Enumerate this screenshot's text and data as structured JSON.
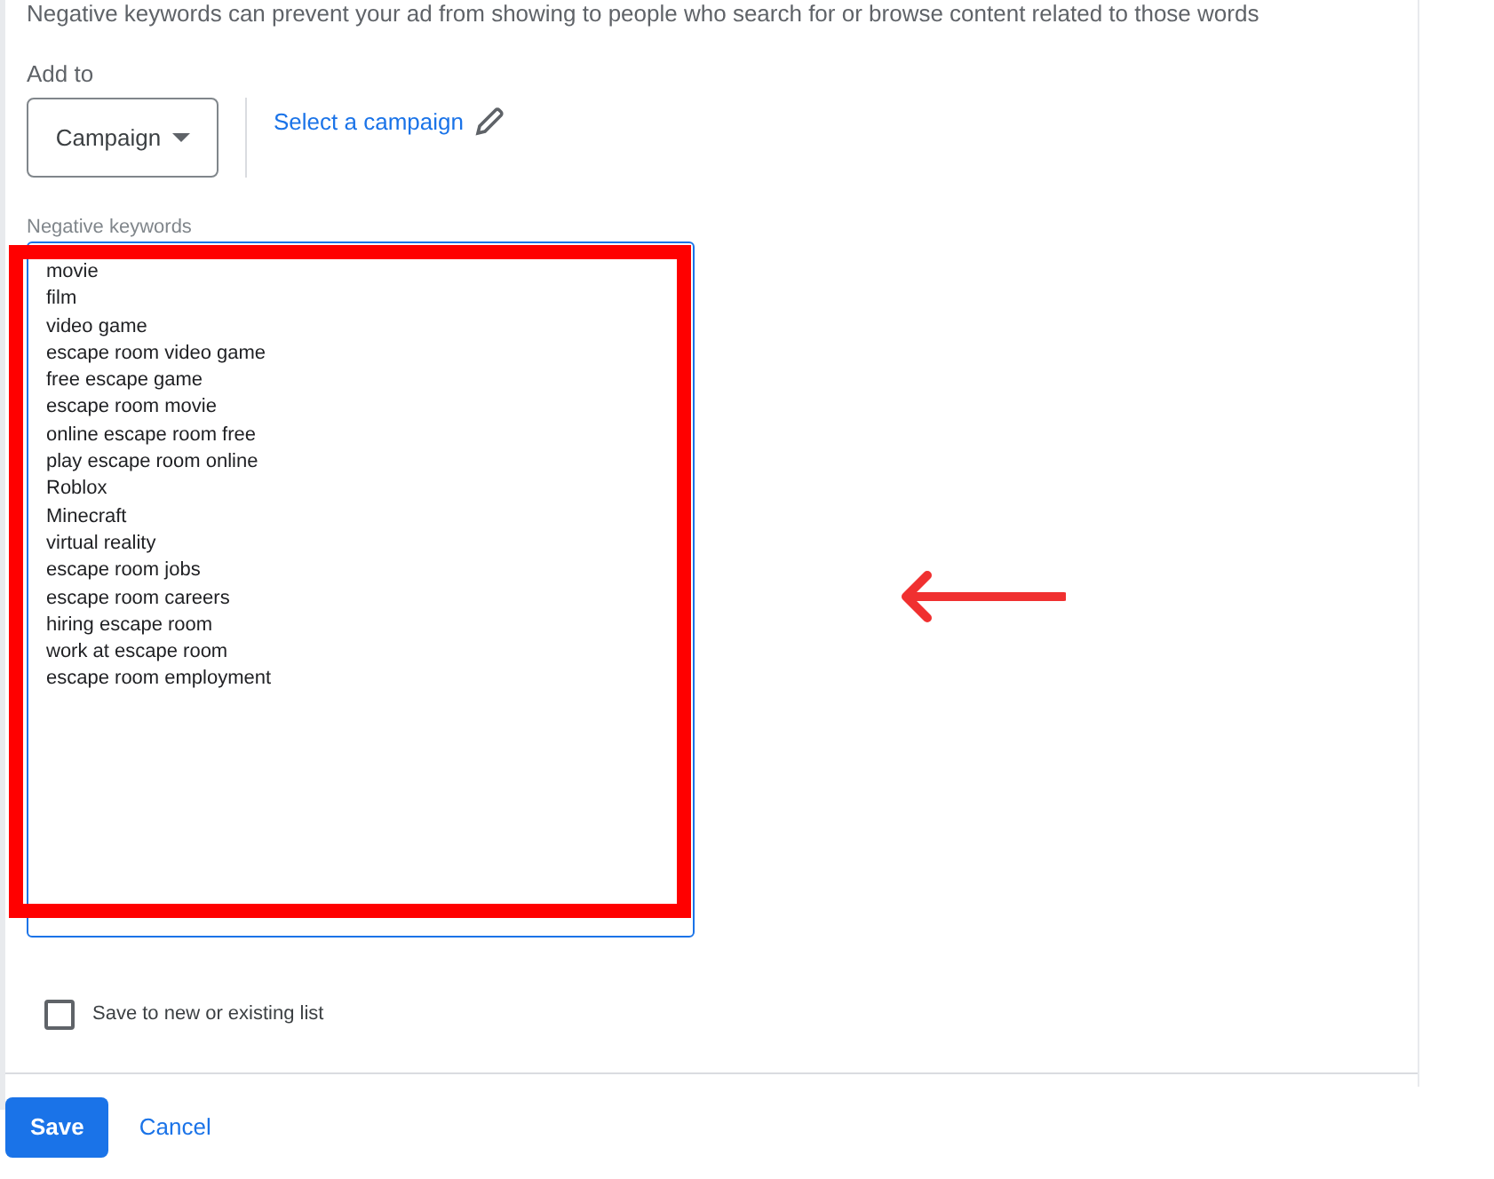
{
  "description": "Negative keywords can prevent your ad from showing to people who search for or browse content related to those words",
  "add_to": {
    "label": "Add to",
    "dropdown": "Campaign",
    "link": "Select a campaign"
  },
  "keywords_field": {
    "label": "Negative keywords",
    "lines": [
      "movie",
      "film",
      "video game",
      "escape room video game",
      "free escape game",
      "escape room movie",
      "online escape room free",
      "play escape room online",
      "Roblox",
      "Minecraft",
      "virtual reality",
      "escape room jobs",
      "escape room careers",
      "hiring escape room",
      "work at escape room",
      "escape room employment"
    ]
  },
  "save_to_list": {
    "label": "Save to new or existing list",
    "checked": false
  },
  "buttons": [
    {
      "kind": "primary",
      "label": "Save"
    },
    {
      "kind": "text",
      "label": "Cancel"
    }
  ],
  "annotation": {
    "highlight_frame": true,
    "arrow": true
  }
}
